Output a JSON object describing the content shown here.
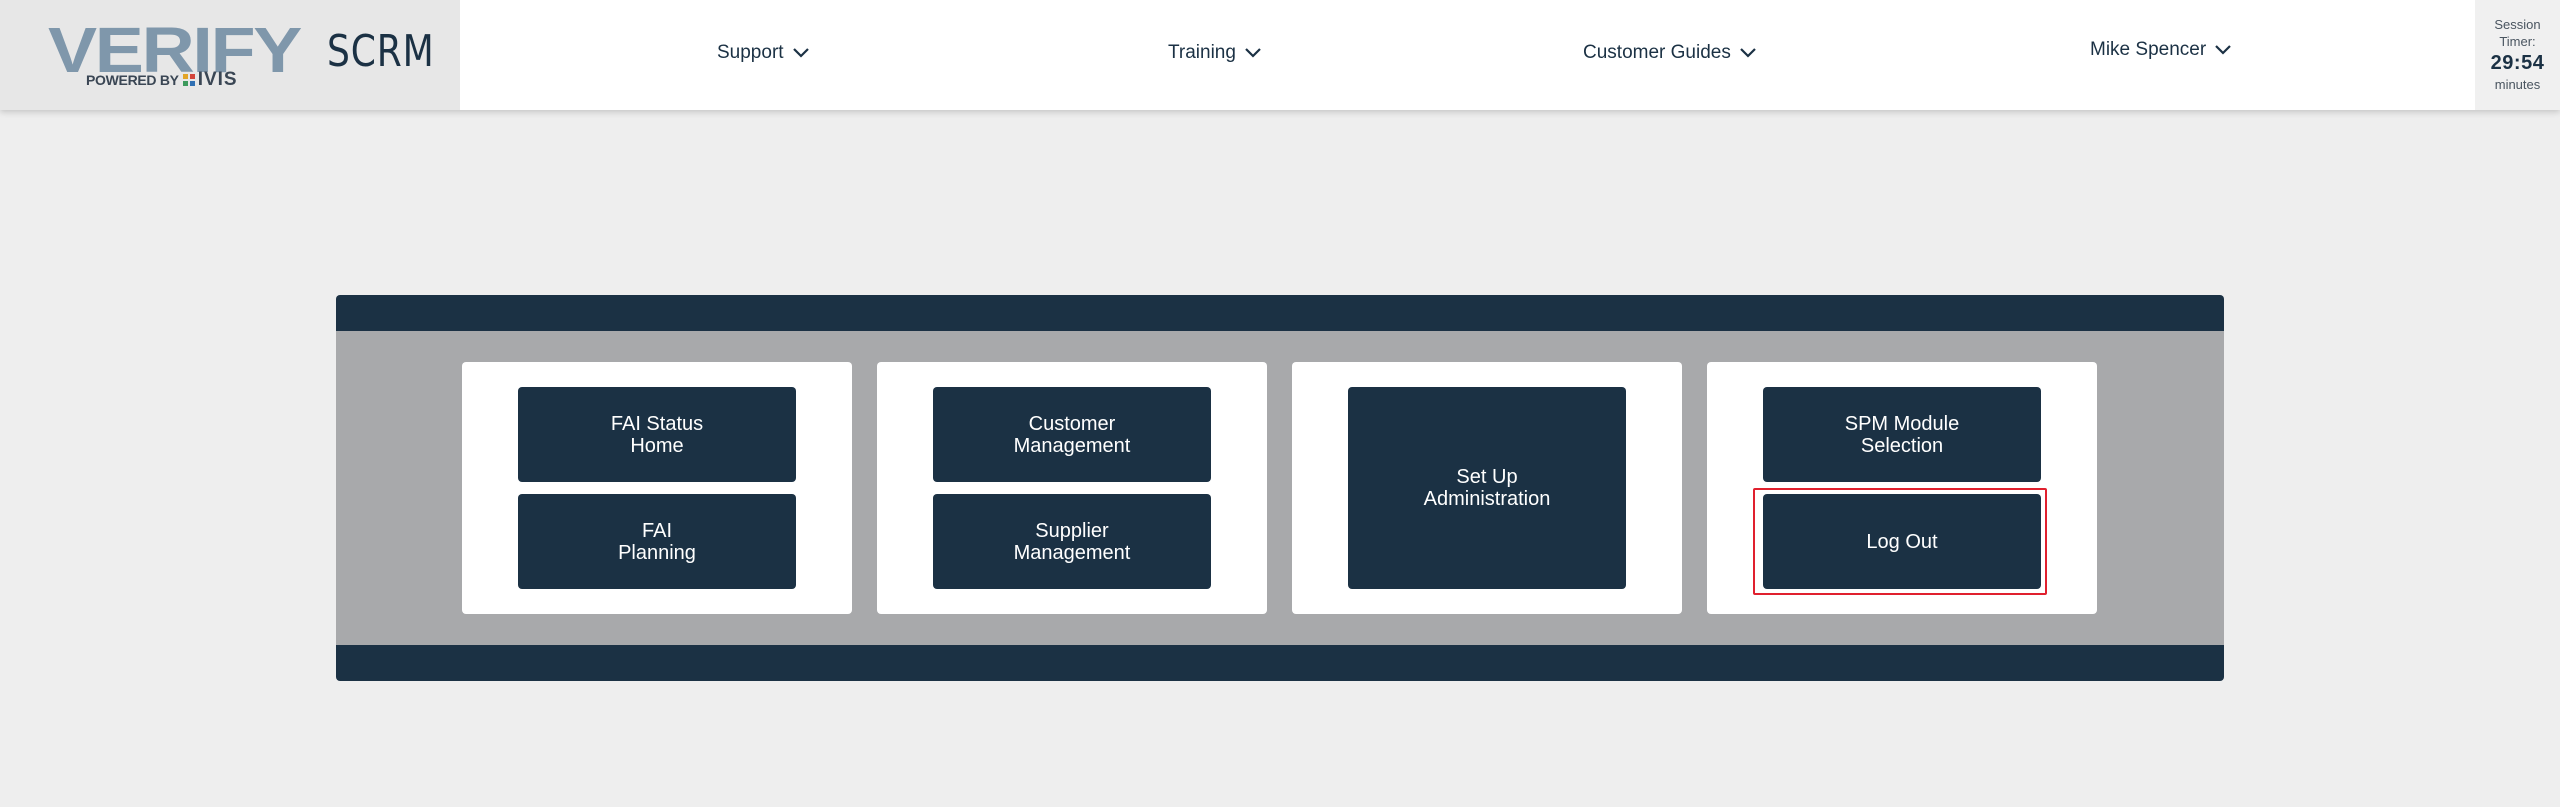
{
  "brand": {
    "logo_word": "VERIFY",
    "logo_powered_by": "POWERED BY",
    "logo_ivis": "IVIS",
    "app_name": "SCRM"
  },
  "nav": {
    "support": "Support",
    "training": "Training",
    "customer_guides": "Customer Guides",
    "user": "Mike Spencer"
  },
  "session": {
    "label_line1": "Session",
    "label_line2": "Timer:",
    "time": "29:54",
    "unit": "minutes"
  },
  "tiles": {
    "fai_status_home": "FAI Status\nHome",
    "fai_planning": "FAI\nPlanning",
    "customer_management": "Customer\nManagement",
    "supplier_management": "Supplier\nManagement",
    "set_up_administration": "Set Up\nAdministration",
    "spm_module_selection": "SPM Module\nSelection",
    "log_out": "Log Out"
  },
  "colors": {
    "navy": "#1b3144",
    "panel_gray": "#a8a9ab",
    "page_bg": "#eeeeee",
    "highlight_red": "#e0202e"
  }
}
